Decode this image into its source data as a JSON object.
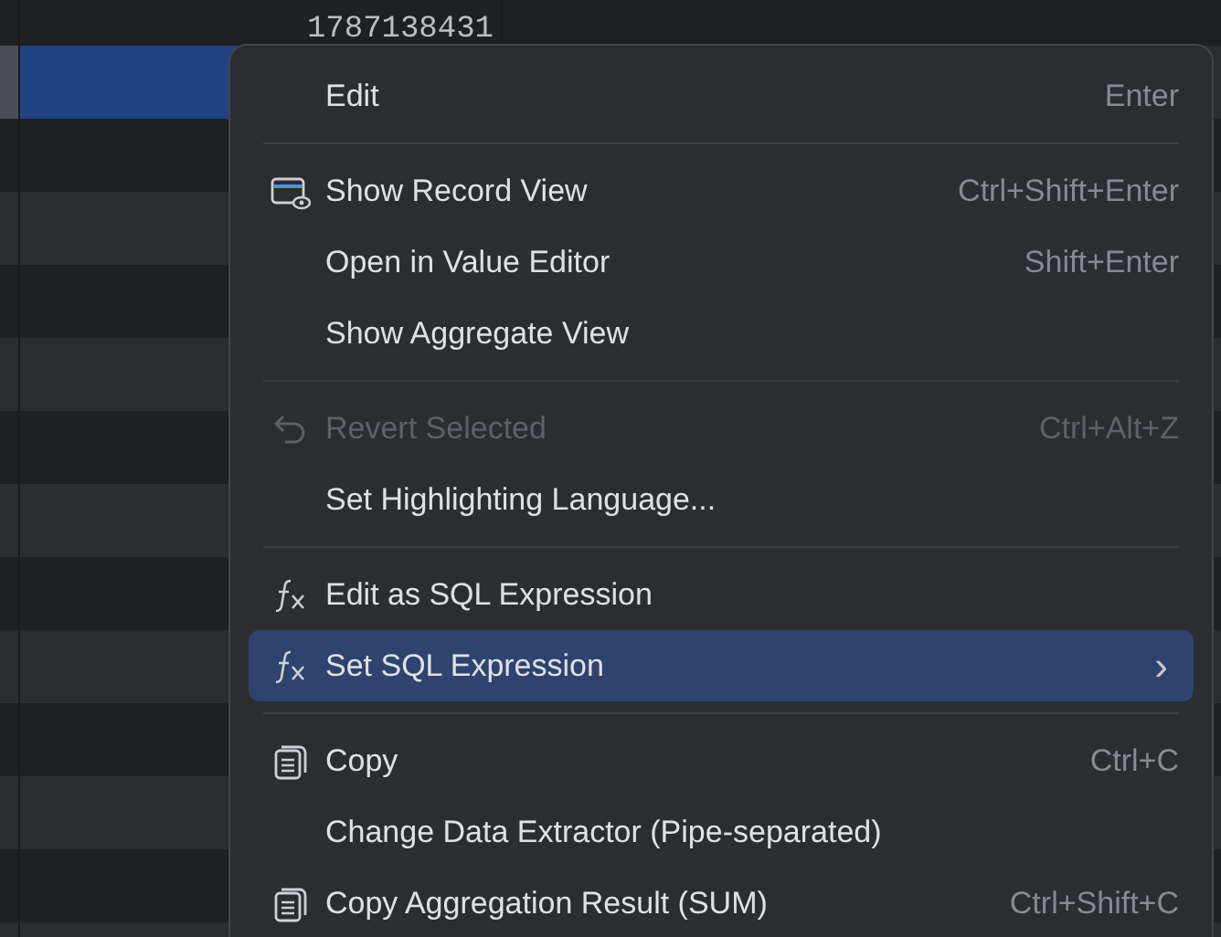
{
  "table": {
    "rows": [
      {
        "value": "1787138431",
        "selected": false
      },
      {
        "selected": true
      },
      {
        "selected": false
      },
      {
        "selected": false
      },
      {
        "selected": false
      },
      {
        "selected": false
      },
      {
        "selected": false
      },
      {
        "selected": false
      },
      {
        "selected": false
      },
      {
        "selected": false
      },
      {
        "selected": false
      },
      {
        "selected": false
      },
      {
        "selected": false
      },
      {
        "selected": false
      }
    ]
  },
  "context_menu": {
    "groups": [
      [
        {
          "kind": "plain",
          "label": "Edit",
          "shortcut": "Enter",
          "disabled": false,
          "selected": false
        }
      ],
      [
        {
          "kind": "record",
          "label": "Show Record View",
          "shortcut": "Ctrl+Shift+Enter",
          "disabled": false,
          "selected": false
        },
        {
          "kind": "plain",
          "label": "Open in Value Editor",
          "shortcut": "Shift+Enter",
          "disabled": false,
          "selected": false
        },
        {
          "kind": "plain",
          "label": "Show Aggregate View",
          "disabled": false,
          "selected": false
        }
      ],
      [
        {
          "kind": "revert",
          "label": "Revert Selected",
          "shortcut": "Ctrl+Alt+Z",
          "disabled": true,
          "selected": false
        },
        {
          "kind": "plain",
          "label": "Set Highlighting Language...",
          "disabled": false,
          "selected": false
        }
      ],
      [
        {
          "kind": "function",
          "label": "Edit as SQL Expression",
          "disabled": false,
          "selected": false
        },
        {
          "kind": "function",
          "label": "Set SQL Expression",
          "submenu": "›",
          "disabled": false,
          "selected": true
        }
      ],
      [
        {
          "kind": "copy",
          "label": "Copy",
          "shortcut": "Ctrl+C",
          "disabled": false,
          "selected": false
        },
        {
          "kind": "plain",
          "label": "Change Data Extractor (Pipe-separated)",
          "disabled": false,
          "selected": false
        },
        {
          "kind": "copy",
          "label": "Copy Aggregation Result (SUM)",
          "shortcut": "Ctrl+Shift+C",
          "disabled": false,
          "selected": false
        }
      ]
    ]
  }
}
